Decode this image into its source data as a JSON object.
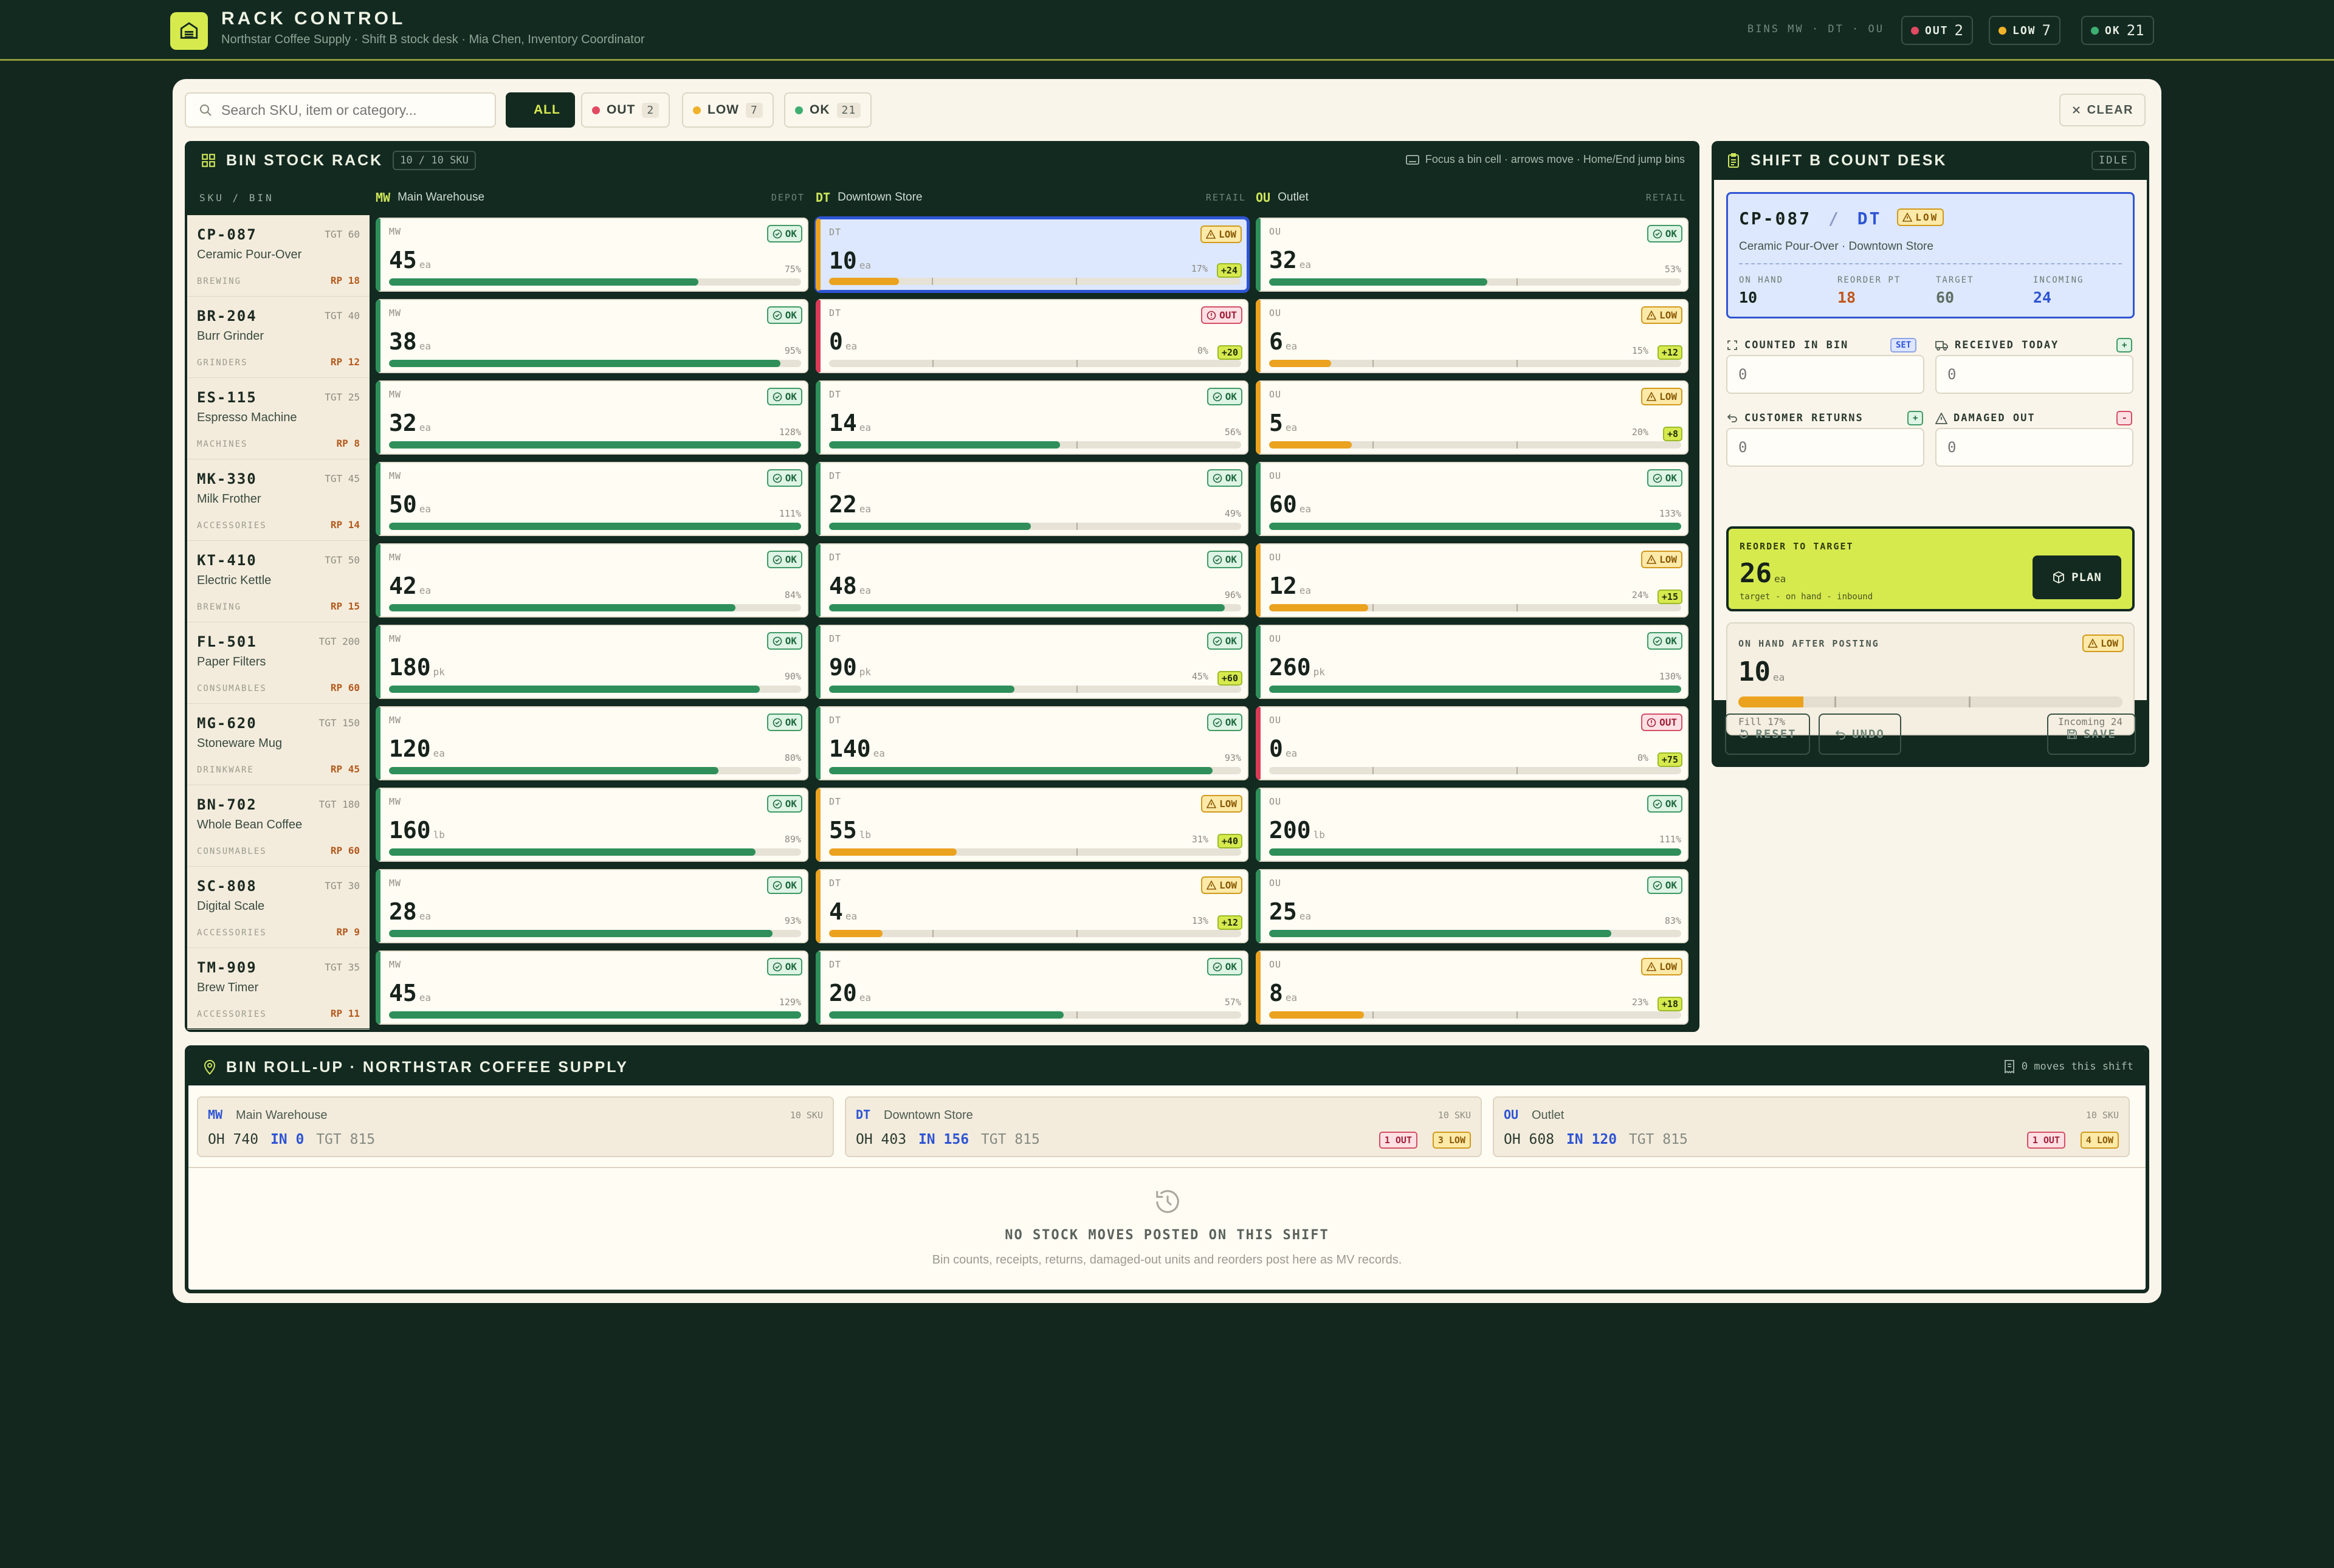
{
  "app": {
    "title": "RACK CONTROL",
    "subtitle": "Northstar Coffee Supply · Shift B stock desk · Mia Chen, Inventory Coordinator",
    "bins_meta": "BINS MW · DT · OU",
    "counts": [
      {
        "label": "OUT",
        "value": "2",
        "color": "#e04a62"
      },
      {
        "label": "LOW",
        "value": "7",
        "color": "#f0b22a"
      },
      {
        "label": "OK",
        "value": "21",
        "color": "#3fae72"
      }
    ]
  },
  "toolbar": {
    "search_placeholder": "Search SKU, item or category...",
    "filters": [
      {
        "label": "ALL",
        "count": ""
      },
      {
        "label": "OUT",
        "count": "2"
      },
      {
        "label": "LOW",
        "count": "7"
      },
      {
        "label": "OK",
        "count": "21"
      }
    ],
    "clear_label": "CLEAR"
  },
  "rack": {
    "title": "BIN STOCK RACK",
    "sku_count": "10 / 10 SKU",
    "hint": "Focus a bin cell · arrows move · Home/End jump bins",
    "sku_header": "SKU / BIN",
    "bins": [
      {
        "code": "MW",
        "name": "Main Warehouse",
        "kind": "DEPOT"
      },
      {
        "code": "DT",
        "name": "Downtown Store",
        "kind": "RETAIL"
      },
      {
        "code": "OU",
        "name": "Outlet",
        "kind": "RETAIL"
      }
    ],
    "rows": [
      {
        "code": "CP-087",
        "tgt": "TGT 60",
        "name": "Ceramic Pour-Over",
        "cat": "BREWING",
        "rp": "RP 18",
        "cells": [
          {
            "qty": "45",
            "unit": "ea",
            "status": "OK",
            "pct": "75%",
            "fill": 0.75,
            "inc": ""
          },
          {
            "qty": "10",
            "unit": "ea",
            "status": "LOW",
            "pct": "17%",
            "fill": 0.17,
            "inc": "+24"
          },
          {
            "qty": "32",
            "unit": "ea",
            "status": "OK",
            "pct": "53%",
            "fill": 0.53,
            "inc": ""
          }
        ]
      },
      {
        "code": "BR-204",
        "tgt": "TGT 40",
        "name": "Burr Grinder",
        "cat": "GRINDERS",
        "rp": "RP 12",
        "cells": [
          {
            "qty": "38",
            "unit": "ea",
            "status": "OK",
            "pct": "95%",
            "fill": 0.95,
            "inc": ""
          },
          {
            "qty": "0",
            "unit": "ea",
            "status": "OUT",
            "pct": "0%",
            "fill": 0,
            "inc": "+20"
          },
          {
            "qty": "6",
            "unit": "ea",
            "status": "LOW",
            "pct": "15%",
            "fill": 0.15,
            "inc": "+12"
          }
        ]
      },
      {
        "code": "ES-115",
        "tgt": "TGT 25",
        "name": "Espresso Machine",
        "cat": "MACHINES",
        "rp": "RP 8",
        "cells": [
          {
            "qty": "32",
            "unit": "ea",
            "status": "OK",
            "pct": "128%",
            "fill": 1,
            "inc": ""
          },
          {
            "qty": "14",
            "unit": "ea",
            "status": "OK",
            "pct": "56%",
            "fill": 0.56,
            "inc": ""
          },
          {
            "qty": "5",
            "unit": "ea",
            "status": "LOW",
            "pct": "20%",
            "fill": 0.2,
            "inc": "+8"
          }
        ]
      },
      {
        "code": "MK-330",
        "tgt": "TGT 45",
        "name": "Milk Frother",
        "cat": "ACCESSORIES",
        "rp": "RP 14",
        "cells": [
          {
            "qty": "50",
            "unit": "ea",
            "status": "OK",
            "pct": "111%",
            "fill": 1,
            "inc": ""
          },
          {
            "qty": "22",
            "unit": "ea",
            "status": "OK",
            "pct": "49%",
            "fill": 0.49,
            "inc": ""
          },
          {
            "qty": "60",
            "unit": "ea",
            "status": "OK",
            "pct": "133%",
            "fill": 1,
            "inc": ""
          }
        ]
      },
      {
        "code": "KT-410",
        "tgt": "TGT 50",
        "name": "Electric Kettle",
        "cat": "BREWING",
        "rp": "RP 15",
        "cells": [
          {
            "qty": "42",
            "unit": "ea",
            "status": "OK",
            "pct": "84%",
            "fill": 0.84,
            "inc": ""
          },
          {
            "qty": "48",
            "unit": "ea",
            "status": "OK",
            "pct": "96%",
            "fill": 0.96,
            "inc": ""
          },
          {
            "qty": "12",
            "unit": "ea",
            "status": "LOW",
            "pct": "24%",
            "fill": 0.24,
            "inc": "+15"
          }
        ]
      },
      {
        "code": "FL-501",
        "tgt": "TGT 200",
        "name": "Paper Filters",
        "cat": "CONSUMABLES",
        "rp": "RP 60",
        "cells": [
          {
            "qty": "180",
            "unit": "pk",
            "status": "OK",
            "pct": "90%",
            "fill": 0.9,
            "inc": ""
          },
          {
            "qty": "90",
            "unit": "pk",
            "status": "OK",
            "pct": "45%",
            "fill": 0.45,
            "inc": "+60"
          },
          {
            "qty": "260",
            "unit": "pk",
            "status": "OK",
            "pct": "130%",
            "fill": 1,
            "inc": ""
          }
        ]
      },
      {
        "code": "MG-620",
        "tgt": "TGT 150",
        "name": "Stoneware Mug",
        "cat": "DRINKWARE",
        "rp": "RP 45",
        "cells": [
          {
            "qty": "120",
            "unit": "ea",
            "status": "OK",
            "pct": "80%",
            "fill": 0.8,
            "inc": ""
          },
          {
            "qty": "140",
            "unit": "ea",
            "status": "OK",
            "pct": "93%",
            "fill": 0.93,
            "inc": ""
          },
          {
            "qty": "0",
            "unit": "ea",
            "status": "OUT",
            "pct": "0%",
            "fill": 0,
            "inc": "+75"
          }
        ]
      },
      {
        "code": "BN-702",
        "tgt": "TGT 180",
        "name": "Whole Bean Coffee",
        "cat": "CONSUMABLES",
        "rp": "RP 60",
        "cells": [
          {
            "qty": "160",
            "unit": "lb",
            "status": "OK",
            "pct": "89%",
            "fill": 0.89,
            "inc": ""
          },
          {
            "qty": "55",
            "unit": "lb",
            "status": "LOW",
            "pct": "31%",
            "fill": 0.31,
            "inc": "+40"
          },
          {
            "qty": "200",
            "unit": "lb",
            "status": "OK",
            "pct": "111%",
            "fill": 1,
            "inc": ""
          }
        ]
      },
      {
        "code": "SC-808",
        "tgt": "TGT 30",
        "name": "Digital Scale",
        "cat": "ACCESSORIES",
        "rp": "RP 9",
        "cells": [
          {
            "qty": "28",
            "unit": "ea",
            "status": "OK",
            "pct": "93%",
            "fill": 0.93,
            "inc": ""
          },
          {
            "qty": "4",
            "unit": "ea",
            "status": "LOW",
            "pct": "13%",
            "fill": 0.13,
            "inc": "+12"
          },
          {
            "qty": "25",
            "unit": "ea",
            "status": "OK",
            "pct": "83%",
            "fill": 0.83,
            "inc": ""
          }
        ]
      },
      {
        "code": "TM-909",
        "tgt": "TGT 35",
        "name": "Brew Timer",
        "cat": "ACCESSORIES",
        "rp": "RP 11",
        "cells": [
          {
            "qty": "45",
            "unit": "ea",
            "status": "OK",
            "pct": "129%",
            "fill": 1,
            "inc": ""
          },
          {
            "qty": "20",
            "unit": "ea",
            "status": "OK",
            "pct": "57%",
            "fill": 0.57,
            "inc": ""
          },
          {
            "qty": "8",
            "unit": "ea",
            "status": "LOW",
            "pct": "23%",
            "fill": 0.23,
            "inc": "+18"
          }
        ]
      }
    ]
  },
  "desk": {
    "title": "SHIFT B COUNT DESK",
    "state": "IDLE",
    "selected": {
      "code": "CP-087",
      "sep": "/",
      "bin": "DT",
      "status": "LOW",
      "desc": "Ceramic Pour-Over · Downtown Store",
      "stats": [
        {
          "label": "ON HAND",
          "value": "10",
          "color": "#16221b"
        },
        {
          "label": "REORDER PT",
          "value": "18",
          "color": "#c0551e"
        },
        {
          "label": "TARGET",
          "value": "60",
          "color": "#5f6e64"
        },
        {
          "label": "INCOMING",
          "value": "24",
          "color": "#2f55d4"
        }
      ]
    },
    "fields": {
      "counted": {
        "label": "COUNTED IN BIN",
        "tag": "SET",
        "placeholder": "0"
      },
      "received": {
        "label": "RECEIVED TODAY",
        "tag": "+",
        "placeholder": "0"
      },
      "returns": {
        "label": "CUSTOMER RETURNS",
        "tag": "+",
        "placeholder": "0"
      },
      "damaged": {
        "label": "DAMAGED OUT",
        "tag": "-",
        "placeholder": "0"
      }
    },
    "reorder": {
      "label": "REORDER TO TARGET",
      "value": "26",
      "unit": "ea",
      "formula": "target - on hand - inbound",
      "plan_label": "PLAN"
    },
    "after": {
      "label": "ON HAND AFTER POSTING",
      "value": "10",
      "unit": "ea",
      "status": "LOW",
      "fill": 0.17,
      "fill_text": "Fill 17%",
      "incoming_text": "Incoming 24"
    },
    "buttons": {
      "reset": "RESET",
      "undo": "UNDO",
      "save": "SAVE"
    }
  },
  "rollup": {
    "title": "BIN ROLL-UP · NORTHSTAR COFFEE SUPPLY",
    "moves": "0 moves this shift",
    "bins": [
      {
        "code": "MW",
        "name": "Main Warehouse",
        "skus": "10 SKU",
        "oh": "OH 740",
        "in": "IN 0",
        "tgt": "TGT 815",
        "out": "",
        "low": ""
      },
      {
        "code": "DT",
        "name": "Downtown Store",
        "skus": "10 SKU",
        "oh": "OH 403",
        "in": "IN 156",
        "tgt": "TGT 815",
        "out": "1 OUT",
        "low": "3 LOW"
      },
      {
        "code": "OU",
        "name": "Outlet",
        "skus": "10 SKU",
        "oh": "OH 608",
        "in": "IN 120",
        "tgt": "TGT 815",
        "out": "1 OUT",
        "low": "4 LOW"
      }
    ],
    "empty_title": "NO STOCK MOVES POSTED ON THIS SHIFT",
    "empty_sub": "Bin counts, receipts, returns, damaged-out units and reorders post here as MV records."
  },
  "colors": {
    "ok": "#2f8f5a",
    "low": "#eba21f",
    "out": "#d93b56",
    "accent": "#d6ea4e",
    "dark": "#132a21",
    "select": "#2f55d4"
  }
}
